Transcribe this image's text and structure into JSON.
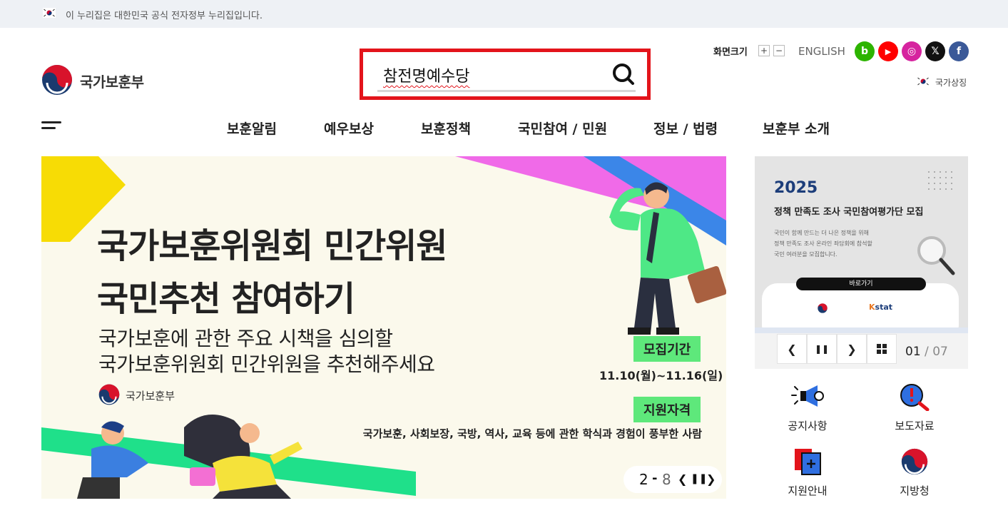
{
  "gov_banner": {
    "text": "이 누리집은 대한민국 공식 전자정부 누리집입니다."
  },
  "logo": {
    "text": "국가보훈부"
  },
  "search": {
    "value": "참전명예수당"
  },
  "utility": {
    "font_size_label": "화면크기",
    "increase": "+",
    "decrease": "−",
    "english": "ENGLISH",
    "national_symbol": "국가상징",
    "sns": [
      {
        "name": "blog-icon",
        "glyph": "b",
        "color": "#2db400"
      },
      {
        "name": "youtube-icon",
        "glyph": "▶",
        "color": "#ff0000"
      },
      {
        "name": "instagram-icon",
        "glyph": "◎",
        "color": "#d6249f"
      },
      {
        "name": "x-icon",
        "glyph": "𝕏",
        "color": "#111111"
      },
      {
        "name": "facebook-icon",
        "glyph": "f",
        "color": "#3b5998"
      }
    ]
  },
  "nav": {
    "items": [
      "보훈알림",
      "예우보상",
      "보훈정책",
      "국민참여 / 민원",
      "정보 / 법령",
      "보훈부 소개"
    ]
  },
  "main_banner": {
    "title_line1": "국가보훈위원회 민간위원",
    "title_line2": "국민추천 참여하기",
    "sub_line1": "국가보훈에 관한 주요 시책을 심의할",
    "sub_line2": "국가보훈위원회 민간위원을 추천해주세요",
    "logo_text": "국가보훈부",
    "tag_period": "모집기간",
    "period": "11.10(월)~11.16(일)",
    "tag_qualification": "지원자격",
    "qualification": "국가보훈, 사회보장, 국방, 역사, 교육 등에 관한 학식과 경험이 풍부한 사람",
    "pager_current": "2",
    "pager_separator": "-",
    "pager_total": "8",
    "accent_colors": {
      "yellow": "#f7dc05",
      "magenta": "#f06ae8",
      "blue": "#3b86e8",
      "green": "#1fe08a"
    }
  },
  "side_banner": {
    "year": "2025",
    "headline": "정책 만족도 조사 국민참여평가단 모집",
    "body_line1": "국민이 함께 만드는 더 나은 정책을 위해",
    "body_line2": "정책 만족도 조사 온라인 좌담회에 참석할",
    "body_line3": "국민 여러분을 모집합니다.",
    "go_button": "바로가기",
    "counter_current": "01",
    "counter_sep": " / ",
    "counter_total": "07"
  },
  "quick_links": [
    {
      "label": "공지사항",
      "icon": "megaphone-icon"
    },
    {
      "label": "보도자료",
      "icon": "magnifier-alert-icon"
    },
    {
      "label": "지원안내",
      "icon": "document-plus-icon"
    },
    {
      "label": "지방청",
      "icon": "taegeuk-icon"
    }
  ]
}
